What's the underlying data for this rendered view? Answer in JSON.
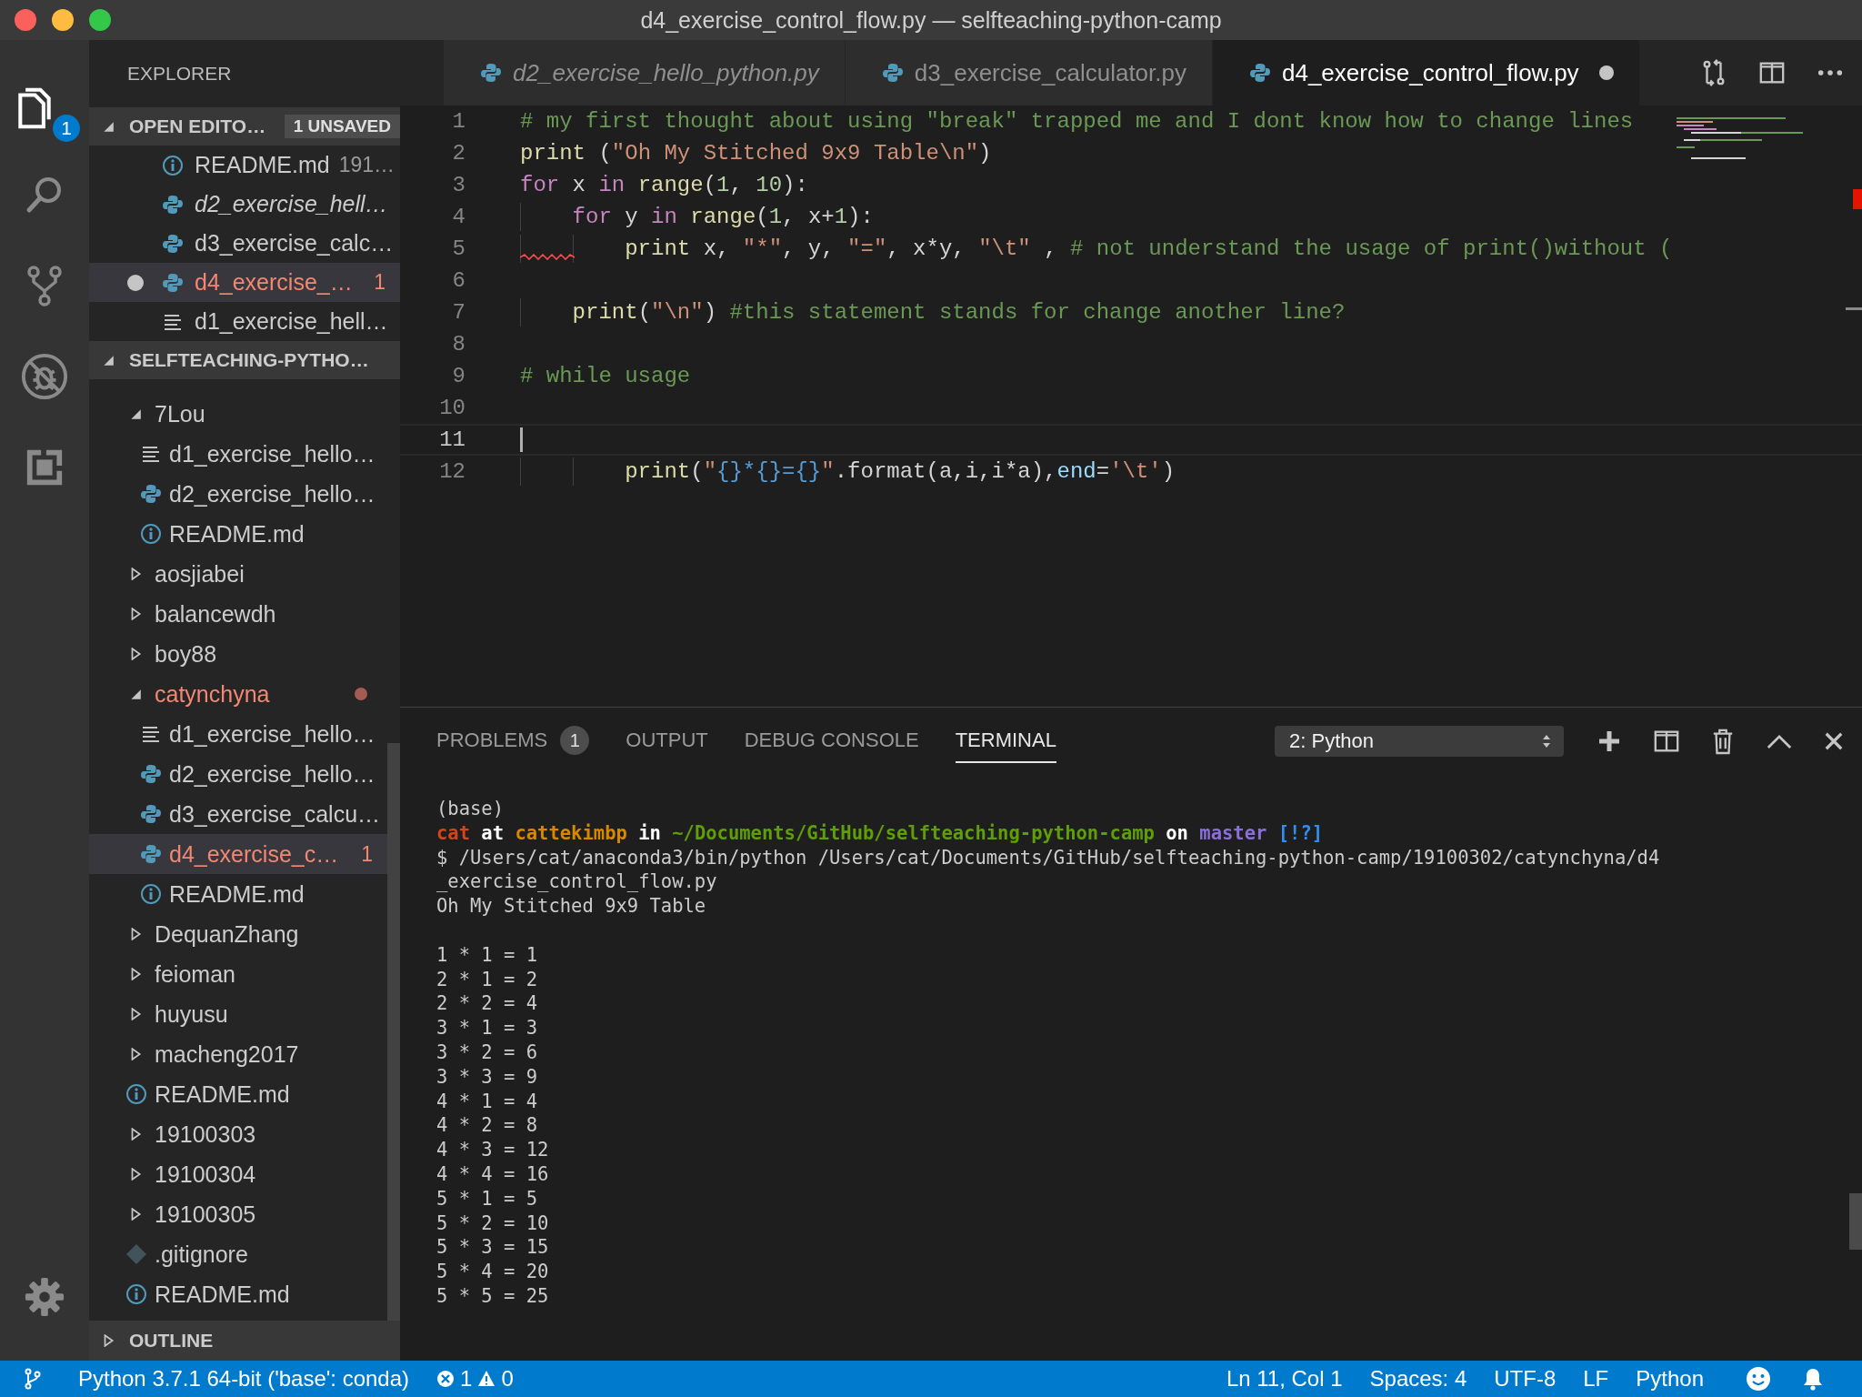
{
  "window": {
    "title": "d4_exercise_control_flow.py — selfteaching-python-camp"
  },
  "activity_bar": {
    "explorer_badge": "1"
  },
  "sidebar": {
    "title": "EXPLORER",
    "open_editors": {
      "title": "OPEN EDITO…",
      "badge": "1 UNSAVED",
      "expanded": true,
      "items": [
        {
          "name": "README.md",
          "description": "191…",
          "kind": "info",
          "preview": false,
          "dirty": false,
          "problem": false,
          "selected": false
        },
        {
          "name": "d2_exercise_hell…",
          "kind": "python",
          "preview": true,
          "dirty": false,
          "problem": false,
          "selected": false
        },
        {
          "name": "d3_exercise_calc…",
          "kind": "python",
          "preview": false,
          "dirty": false,
          "problem": false,
          "selected": false
        },
        {
          "name": "d4_exercise_…",
          "kind": "python",
          "preview": false,
          "dirty": true,
          "problem": true,
          "badge": "1",
          "selected": true
        },
        {
          "name": "d1_exercise_hell…",
          "kind": "lines",
          "preview": false,
          "dirty": false,
          "problem": false,
          "selected": false
        }
      ]
    },
    "folder": {
      "title": "SELFTEACHING-PYTHO…",
      "expanded": true,
      "tree": [
        {
          "children": [
            {
              "name": "7Lou",
              "kind": "folder",
              "expanded": true,
              "problem": false,
              "selected": false,
              "children": [
                {
                  "name": "d1_exercise_hello…",
                  "kind": "lines",
                  "problem": false,
                  "selected": false
                },
                {
                  "name": "d2_exercise_hello…",
                  "kind": "python",
                  "problem": false,
                  "selected": false
                },
                {
                  "name": "README.md",
                  "kind": "info",
                  "problem": false,
                  "selected": false
                }
              ]
            },
            {
              "name": "aosjiabei",
              "kind": "folder",
              "expanded": false,
              "problem": false,
              "selected": false
            },
            {
              "name": "balancewdh",
              "kind": "folder",
              "expanded": false,
              "problem": false,
              "selected": false
            },
            {
              "name": "boy88",
              "kind": "folder",
              "expanded": false,
              "problem": false,
              "selected": false
            },
            {
              "name": "catynchyna",
              "kind": "folder",
              "expanded": true,
              "problem": true,
              "selected": false,
              "children": [
                {
                  "name": "d1_exercise_hello…",
                  "kind": "lines",
                  "problem": false,
                  "selected": false
                },
                {
                  "name": "d2_exercise_hello…",
                  "kind": "python",
                  "problem": false,
                  "selected": false
                },
                {
                  "name": "d3_exercise_calcu…",
                  "kind": "python",
                  "problem": false,
                  "selected": false
                },
                {
                  "name": "d4_exercise_c…",
                  "kind": "python",
                  "problem": true,
                  "badge": "1",
                  "selected": true
                },
                {
                  "name": "README.md",
                  "kind": "info",
                  "problem": false,
                  "selected": false
                }
              ]
            },
            {
              "name": "DequanZhang",
              "kind": "folder",
              "expanded": false,
              "problem": false,
              "selected": false
            },
            {
              "name": "feioman",
              "kind": "folder",
              "expanded": false,
              "problem": false,
              "selected": false
            },
            {
              "name": "huyusu",
              "kind": "folder",
              "expanded": false,
              "problem": false,
              "selected": false
            },
            {
              "name": "macheng2017",
              "kind": "folder",
              "expanded": false,
              "problem": false,
              "selected": false
            },
            {
              "name": "README.md",
              "kind": "info",
              "problem": false,
              "selected": false
            }
          ]
        },
        {
          "name": "19100303",
          "kind": "folder",
          "expanded": false,
          "problem": false,
          "selected": false
        },
        {
          "name": "19100304",
          "kind": "folder",
          "expanded": false,
          "problem": false,
          "selected": false
        },
        {
          "name": "19100305",
          "kind": "folder",
          "expanded": false,
          "problem": false,
          "selected": false
        },
        {
          "name": ".gitignore",
          "kind": "git",
          "problem": false,
          "selected": false
        },
        {
          "name": "README.md",
          "kind": "info",
          "problem": false,
          "selected": false
        }
      ]
    },
    "outline": {
      "title": "OUTLINE",
      "expanded": false
    }
  },
  "tabs": [
    {
      "label": "d2_exercise_hello_python.py",
      "preview": true,
      "dirty": false,
      "selected": false
    },
    {
      "label": "d3_exercise_calculator.py",
      "preview": false,
      "dirty": false,
      "selected": false
    },
    {
      "label": "d4_exercise_control_flow.py",
      "preview": false,
      "dirty": true,
      "selected": true
    }
  ],
  "editor": {
    "lines": [
      {
        "number": "1",
        "current": false,
        "error": false,
        "tokens": [
          {
            "text": "# my first thought about using \"break\" trapped me and I dont know how to change lines",
            "kind": "comment"
          }
        ]
      },
      {
        "number": "2",
        "current": false,
        "error": false,
        "tokens": [
          {
            "text": "print",
            "kind": "func"
          },
          {
            "text": " (",
            "kind": "plain"
          },
          {
            "text": "\"Oh My Stitched 9x9 Table\\n\"",
            "kind": "string"
          },
          {
            "text": ")",
            "kind": "plain"
          }
        ]
      },
      {
        "number": "3",
        "current": false,
        "error": false,
        "tokens": [
          {
            "text": "for",
            "kind": "keyword"
          },
          {
            "text": " x ",
            "kind": "plain"
          },
          {
            "text": "in ",
            "kind": "keyword"
          },
          {
            "text": "range",
            "kind": "func"
          },
          {
            "text": "(",
            "kind": "plain"
          },
          {
            "text": "1",
            "kind": "number"
          },
          {
            "text": ", ",
            "kind": "plain"
          },
          {
            "text": "10",
            "kind": "number"
          },
          {
            "text": "):",
            "kind": "plain"
          }
        ]
      },
      {
        "number": "4",
        "current": false,
        "error": false,
        "tokens": [
          {
            "text": "    for",
            "kind": "keyword"
          },
          {
            "text": " y ",
            "kind": "plain"
          },
          {
            "text": "in ",
            "kind": "keyword"
          },
          {
            "text": "range",
            "kind": "func"
          },
          {
            "text": "(",
            "kind": "plain"
          },
          {
            "text": "1",
            "kind": "number"
          },
          {
            "text": ", x+",
            "kind": "plain"
          },
          {
            "text": "1",
            "kind": "number"
          },
          {
            "text": "):",
            "kind": "plain"
          }
        ]
      },
      {
        "number": "5",
        "current": false,
        "error": true,
        "tokens": [
          {
            "text": "        print",
            "kind": "func"
          },
          {
            "text": " x, ",
            "kind": "plain"
          },
          {
            "text": "\"*\"",
            "kind": "string"
          },
          {
            "text": ", y, ",
            "kind": "plain"
          },
          {
            "text": "\"=\"",
            "kind": "string"
          },
          {
            "text": ", x*y, ",
            "kind": "plain"
          },
          {
            "text": "\"\\t\"",
            "kind": "string"
          },
          {
            "text": " , ",
            "kind": "plain"
          },
          {
            "text": "# not understand the usage of print()without (",
            "kind": "comment"
          }
        ]
      },
      {
        "number": "6",
        "current": false,
        "error": false
      },
      {
        "number": "7",
        "current": false,
        "error": false,
        "tokens": [
          {
            "text": "    print",
            "kind": "func"
          },
          {
            "text": "(",
            "kind": "plain"
          },
          {
            "text": "\"\\n\"",
            "kind": "string"
          },
          {
            "text": ") ",
            "kind": "plain"
          },
          {
            "text": "#this statement stands for change another line?",
            "kind": "comment"
          }
        ]
      },
      {
        "number": "8",
        "current": false,
        "error": false
      },
      {
        "number": "9",
        "current": false,
        "error": false,
        "tokens": [
          {
            "text": "# while usage",
            "kind": "comment"
          }
        ]
      },
      {
        "number": "10",
        "current": false,
        "error": false
      },
      {
        "number": "11",
        "current": true,
        "error": false
      },
      {
        "number": "12",
        "current": false,
        "error": false,
        "tokens": [
          {
            "text": "        print",
            "kind": "func"
          },
          {
            "text": "(",
            "kind": "plain"
          },
          {
            "text": "\"",
            "kind": "string"
          },
          {
            "text": "{}*{}={}",
            "kind": "placeholder"
          },
          {
            "text": "\"",
            "kind": "string"
          },
          {
            "text": ".format(a,i,i*a),",
            "kind": "plain"
          },
          {
            "text": "end",
            "kind": "param"
          },
          {
            "text": "=",
            "kind": "plain"
          },
          {
            "text": "'\\t'",
            "kind": "string"
          },
          {
            "text": ")",
            "kind": "plain"
          }
        ]
      }
    ]
  },
  "panel": {
    "tabs": [
      {
        "label": "PROBLEMS",
        "badge": "1",
        "selected": false
      },
      {
        "label": "OUTPUT",
        "selected": false
      },
      {
        "label": "DEBUG CONSOLE",
        "selected": false
      },
      {
        "label": "TERMINAL",
        "selected": true
      }
    ],
    "terminal_select": "2: Python",
    "terminal": {
      "lines": [
        [
          {
            "text": "(base)",
            "kind": "plain"
          }
        ],
        [
          {
            "text": "cat",
            "kind": "user"
          },
          {
            "text": " at ",
            "kind": "bold"
          },
          {
            "text": "cattekimbp",
            "kind": "host"
          },
          {
            "text": " in ",
            "kind": "bold"
          },
          {
            "text": "~/Documents/GitHub/selfteaching-python-camp",
            "kind": "path"
          },
          {
            "text": " on ",
            "kind": "bold"
          },
          {
            "text": "master",
            "kind": "branch"
          },
          {
            "text": " [!?]",
            "kind": "status"
          }
        ],
        [
          {
            "text": "$ /Users/cat/anaconda3/bin/python /Users/cat/Documents/GitHub/selfteaching-python-camp/19100302/catynchyna/d4",
            "kind": "plain"
          }
        ],
        [
          {
            "text": "_exercise_control_flow.py",
            "kind": "plain"
          }
        ],
        [
          {
            "text": "Oh My Stitched 9x9 Table",
            "kind": "plain"
          }
        ]
      ],
      "results": [
        "1 * 1 = 1",
        "2 * 1 = 2",
        "2 * 2 = 4",
        "3 * 1 = 3",
        "3 * 2 = 6",
        "3 * 3 = 9",
        "4 * 1 = 4",
        "4 * 2 = 8",
        "4 * 3 = 12",
        "4 * 4 = 16",
        "5 * 1 = 5",
        "5 * 2 = 10",
        "5 * 3 = 15",
        "5 * 4 = 20",
        "5 * 5 = 25"
      ]
    }
  },
  "status_bar": {
    "interpreter": "Python 3.7.1 64-bit ('base': conda)",
    "errors": "1",
    "warnings": "0",
    "position": "Ln 11, Col 1",
    "indentation": "Spaces: 4",
    "encoding": "UTF-8",
    "line_ending": "LF",
    "language": "Python"
  }
}
